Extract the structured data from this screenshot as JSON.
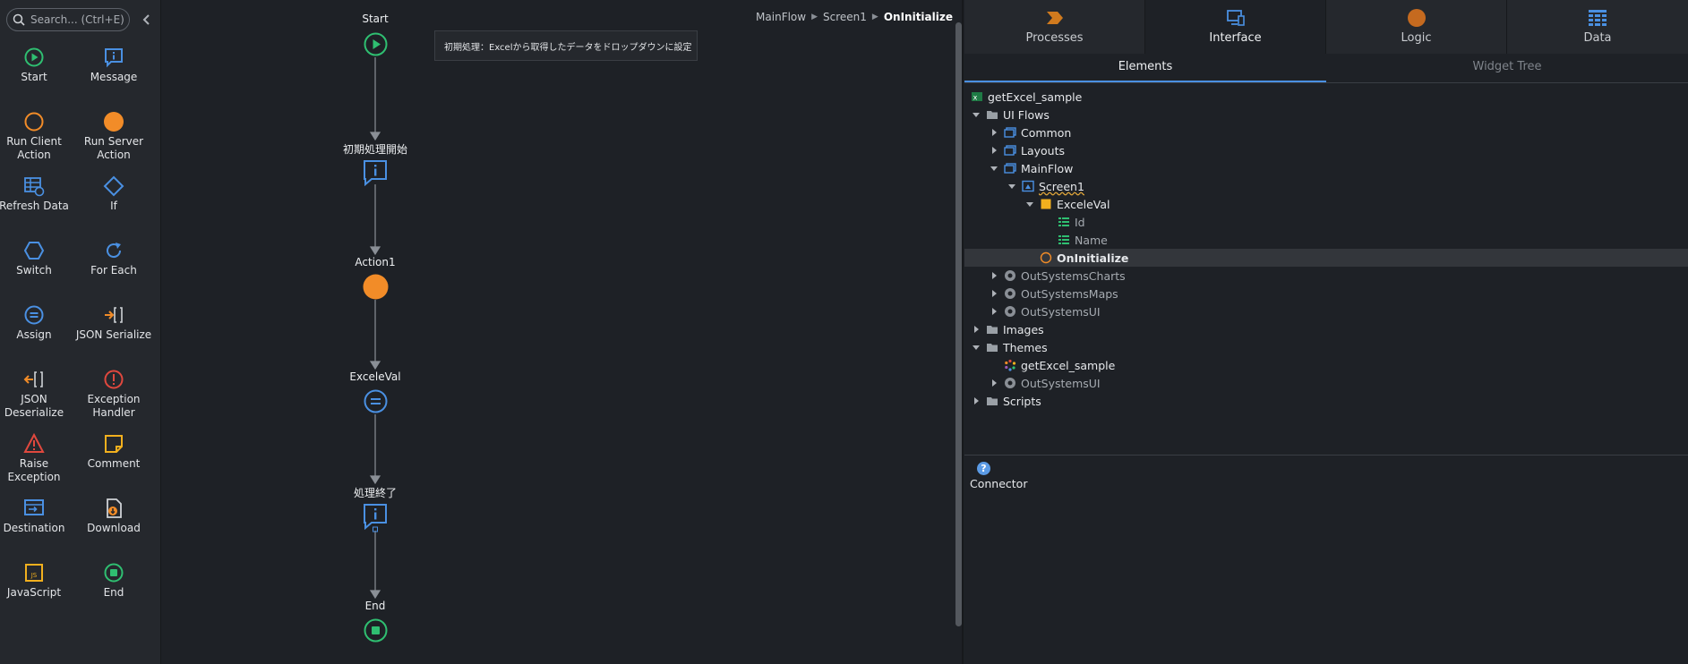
{
  "toolbox": {
    "search_placeholder": "Search... (Ctrl+E)",
    "items": [
      {
        "label": "Start",
        "icon": "play-circle-icon"
      },
      {
        "label": "Message",
        "icon": "message-icon"
      },
      {
        "label": "Run Client Action",
        "icon": "client-action-icon"
      },
      {
        "label": "Run Server Action",
        "icon": "server-action-icon"
      },
      {
        "label": "Refresh Data",
        "icon": "refresh-data-icon"
      },
      {
        "label": "If",
        "icon": "diamond-icon"
      },
      {
        "label": "Switch",
        "icon": "hexagon-icon"
      },
      {
        "label": "For Each",
        "icon": "loop-icon"
      },
      {
        "label": "Assign",
        "icon": "assign-icon"
      },
      {
        "label": "JSON Serialize",
        "icon": "json-serialize-icon"
      },
      {
        "label": "JSON Deserialize",
        "icon": "json-deserialize-icon"
      },
      {
        "label": "Exception Handler",
        "icon": "exception-handler-icon"
      },
      {
        "label": "Raise Exception",
        "icon": "warning-icon"
      },
      {
        "label": "Comment",
        "icon": "comment-icon"
      },
      {
        "label": "Destination",
        "icon": "destination-icon"
      },
      {
        "label": "Download",
        "icon": "download-icon"
      },
      {
        "label": "JavaScript",
        "icon": "javascript-icon"
      },
      {
        "label": "End",
        "icon": "stop-circle-icon"
      }
    ]
  },
  "canvas": {
    "breadcrumb": [
      "MainFlow",
      "Screen1",
      "OnInitialize"
    ],
    "tooltip": "初期処理：Excelから取得したデータをドロップダウンに設定",
    "nodes": [
      {
        "label": "Start"
      },
      {
        "label": "初期処理開始"
      },
      {
        "label": "Action1"
      },
      {
        "label": "ExceleVal"
      },
      {
        "label": "処理終了"
      },
      {
        "label": "End"
      }
    ]
  },
  "panel": {
    "tabs": [
      {
        "label": "Processes",
        "color": "#d07a1e"
      },
      {
        "label": "Interface",
        "color": "#4a90e2"
      },
      {
        "label": "Logic",
        "color": "#c56a1f"
      },
      {
        "label": "Data",
        "color": "#4a90e2"
      }
    ],
    "subtabs": [
      "Elements",
      "Widget Tree"
    ],
    "tree": [
      {
        "label": "getExcel_sample"
      },
      {
        "label": "UI Flows"
      },
      {
        "label": "Common"
      },
      {
        "label": "Layouts"
      },
      {
        "label": "MainFlow"
      },
      {
        "label": "Screen1"
      },
      {
        "label": "ExceleVal"
      },
      {
        "label": "Id"
      },
      {
        "label": "Name"
      },
      {
        "label": "OnInitialize"
      },
      {
        "label": "OutSystemsCharts"
      },
      {
        "label": "OutSystemsMaps"
      },
      {
        "label": "OutSystemsUI"
      },
      {
        "label": "Images"
      },
      {
        "label": "Themes"
      },
      {
        "label": "getExcel_sample"
      },
      {
        "label": "OutSystemsUI"
      },
      {
        "label": "Scripts"
      }
    ],
    "connector_label": "Connector"
  },
  "colors": {
    "accent_green": "#2fbf71",
    "accent_blue": "#4a90e2",
    "accent_orange": "#f28c28",
    "accent_red": "#e0483e",
    "accent_yellow": "#f2b01e"
  }
}
